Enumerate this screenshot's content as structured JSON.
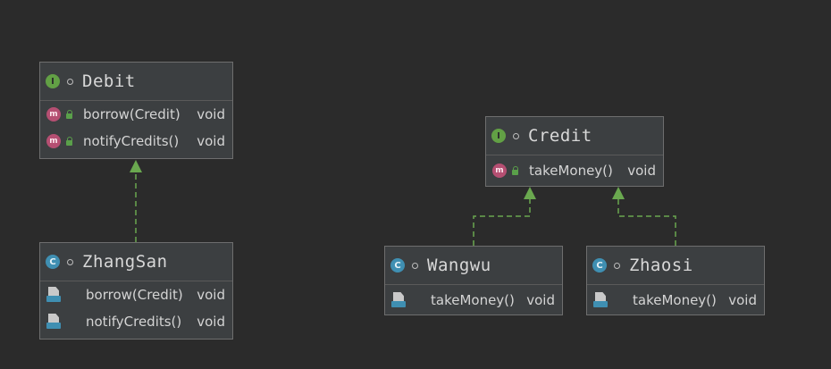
{
  "classes": {
    "debit": {
      "name": "Debit",
      "kind": "interface",
      "badge": "I",
      "methods": [
        {
          "name": "borrow(Credit)",
          "type": "void",
          "icon": "m"
        },
        {
          "name": "notifyCredits()",
          "type": "void",
          "icon": "m"
        }
      ]
    },
    "credit": {
      "name": "Credit",
      "kind": "interface",
      "badge": "I",
      "methods": [
        {
          "name": "takeMoney()",
          "type": "void",
          "icon": "m"
        }
      ]
    },
    "zhangsan": {
      "name": "ZhangSan",
      "kind": "class",
      "badge": "C",
      "methods": [
        {
          "name": "borrow(Credit)",
          "type": "void"
        },
        {
          "name": "notifyCredits()",
          "type": "void"
        }
      ]
    },
    "wangwu": {
      "name": "Wangwu",
      "kind": "class",
      "badge": "C",
      "methods": [
        {
          "name": "takeMoney()",
          "type": "void"
        }
      ]
    },
    "zhaosi": {
      "name": "Zhaosi",
      "kind": "class",
      "badge": "C",
      "methods": [
        {
          "name": "takeMoney()",
          "type": "void"
        }
      ]
    }
  },
  "relations": [
    {
      "from": "zhangsan",
      "to": "debit",
      "type": "implements"
    },
    {
      "from": "wangwu",
      "to": "credit",
      "type": "implements"
    },
    {
      "from": "zhaosi",
      "to": "credit",
      "type": "implements"
    }
  ],
  "colors": {
    "background": "#2b2b2b",
    "box": "#3c3f41",
    "edge": "#6aa84f",
    "interface_badge": "#62a045",
    "class_badge": "#3f8fb2",
    "method_badge": "#b54f72"
  }
}
